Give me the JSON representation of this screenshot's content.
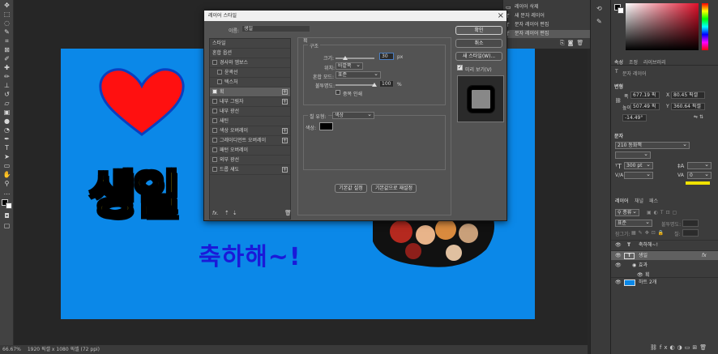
{
  "status_bar": {
    "zoom": "66.67%",
    "doc_info": "1920 픽셀 x 1080 픽셀 (72 ppi)"
  },
  "canvas": {
    "main_text": "생일",
    "sub_text": "축하해~!",
    "colors": {
      "background": "#0b88e8",
      "main_text": "#ffe800",
      "sub_text": "#1a1ad8",
      "heart": "#ff1010"
    }
  },
  "history": {
    "items": [
      {
        "icon": "layer-icon",
        "label": "레이어 삭제"
      },
      {
        "icon": "type-icon",
        "label": "새 문자 레이어"
      },
      {
        "icon": "type-icon",
        "label": "문자 레이어 편집"
      },
      {
        "icon": "type-icon",
        "label": "문자 레이어 편집"
      }
    ]
  },
  "dialog": {
    "title": "레이어 스타일",
    "name_label": "이름:",
    "name_value": "생일",
    "styles_header": "스타일",
    "blend_options": "혼합 옵션",
    "styles": [
      {
        "label": "경사와 엠보스",
        "checked": false,
        "sub": false,
        "plus": false
      },
      {
        "label": "윤곽선",
        "checked": false,
        "sub": true,
        "plus": false
      },
      {
        "label": "텍스처",
        "checked": false,
        "sub": true,
        "plus": false
      },
      {
        "label": "획",
        "checked": true,
        "sub": false,
        "plus": true,
        "selected": true
      },
      {
        "label": "내부 그림자",
        "checked": false,
        "sub": false,
        "plus": true
      },
      {
        "label": "내부 광선",
        "checked": false,
        "sub": false,
        "plus": false
      },
      {
        "label": "새틴",
        "checked": false,
        "sub": false,
        "plus": false
      },
      {
        "label": "색상 오버레이",
        "checked": false,
        "sub": false,
        "plus": true
      },
      {
        "label": "그레이디언트 오버레이",
        "checked": false,
        "sub": false,
        "plus": true
      },
      {
        "label": "패턴 오버레이",
        "checked": false,
        "sub": false,
        "plus": false
      },
      {
        "label": "외부 광선",
        "checked": false,
        "sub": false,
        "plus": false
      },
      {
        "label": "드롭 섀도",
        "checked": false,
        "sub": false,
        "plus": true
      }
    ],
    "footer_fx": "fx.",
    "section_title": "획",
    "structure_title": "구조",
    "size_label": "크기:",
    "size_value": "30",
    "size_unit": "px",
    "position_label": "위치:",
    "position_value": "바깥쪽",
    "blend_mode_label": "혼합 모드:",
    "blend_mode_value": "표준",
    "opacity_label": "불투명도:",
    "opacity_value": "100",
    "opacity_unit": "%",
    "overprint_label": "중복 인쇄",
    "fill_type_label": "칠 유형:",
    "fill_type_value": "색상",
    "color_label": "색상:",
    "stroke_color": "#000000",
    "make_default": "기본값 설정",
    "reset_default": "기본값으로 재설정",
    "ok": "확인",
    "cancel": "취소",
    "new_style": "새 스타일(W)...",
    "preview_label": "미리 보기(V)"
  },
  "right": {
    "props_tabs": [
      "속성",
      "조정",
      "라이브러리"
    ],
    "layer_kind": "문자 레이어",
    "transform_title": "변형",
    "w_label": "폭",
    "w_value": "677.19 픽",
    "h_label": "높이",
    "h_value": "507.49 픽",
    "x_label": "X",
    "x_value": "80.45 픽셀",
    "y_label": "Y",
    "y_value": "360.64 픽셀",
    "angle_value": "-14.49°",
    "char_title": "문자",
    "font_value": "210 동화책",
    "size_value": "300 pt",
    "tracking_value": "0",
    "layers_tabs": [
      "레이어",
      "채널",
      "패스"
    ],
    "kind_label": "종류",
    "blend_value": "표준",
    "opacity_label": "불투명도:",
    "lock_label": "잠그기:",
    "fill_label": "칠:",
    "layers": [
      {
        "icon": "type-icon",
        "name": "축하해~!",
        "indent": 0,
        "fx": false
      },
      {
        "icon": "type-icon",
        "name": "생일",
        "indent": 0,
        "fx": true,
        "selected": true
      },
      {
        "icon": "",
        "name": "효과",
        "indent": 1,
        "fx": false
      },
      {
        "icon": "",
        "name": "획",
        "indent": 2,
        "fx": false
      },
      {
        "icon": "image-icon",
        "name": "하트 2개",
        "indent": 0,
        "fx": false
      }
    ]
  }
}
